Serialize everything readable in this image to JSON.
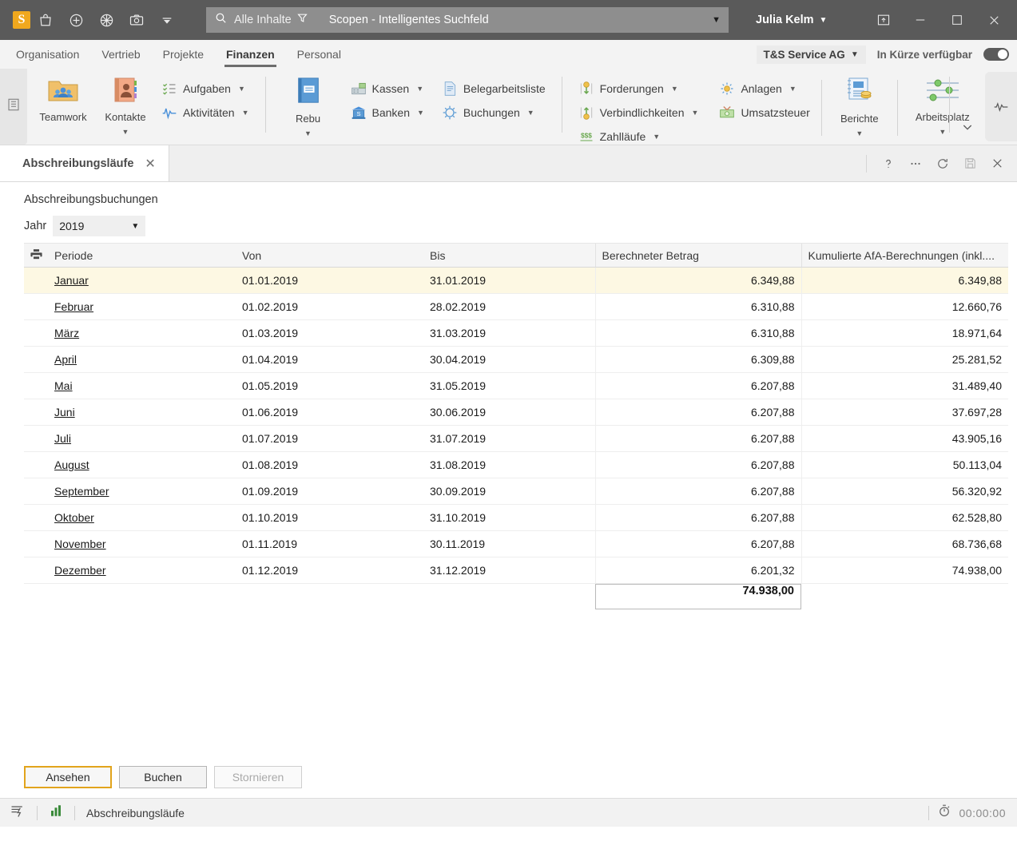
{
  "titlebar": {
    "logo_text": "S",
    "icons": [
      "bag-icon",
      "plus-circle-icon",
      "globe-icon",
      "camera-icon",
      "chevron-down-icon"
    ],
    "search": {
      "icon": "search-icon",
      "scope_label": "Alle Inhalte",
      "filter_icon": "filter-icon",
      "placeholder": "Scopen - Intelligentes Suchfeld",
      "value": "Scopen - Intelligentes Suchfeld",
      "caret": "▼"
    },
    "user": {
      "name": "Julia Kelm",
      "caret": "▼"
    },
    "window_icon": "restore-panel-icon",
    "minimize": "—",
    "maximize": "☐",
    "close": "✕"
  },
  "menubar": {
    "items": [
      {
        "label": "Organisation",
        "active": false
      },
      {
        "label": "Vertrieb",
        "active": false
      },
      {
        "label": "Projekte",
        "active": false
      },
      {
        "label": "Finanzen",
        "active": true
      },
      {
        "label": "Personal",
        "active": false
      }
    ],
    "company": {
      "label": "T&S Service AG",
      "caret": "▼"
    },
    "coming_soon_label": "In Kürze verfügbar",
    "toggle_state": "on"
  },
  "ribbon": {
    "tabstrip_icon": "list-panel-icon",
    "big_buttons": [
      {
        "label": "Teamwork",
        "icon": "teamwork-folder-icon",
        "has_caret": false
      },
      {
        "label": "Kontakte",
        "icon": "contacts-book-icon",
        "has_caret": true
      },
      {
        "label": "Rebu",
        "icon": "rebu-book-icon",
        "has_caret": true
      },
      {
        "label": "Berichte",
        "icon": "reports-icon",
        "has_caret": true
      },
      {
        "label": "Arbeitsplatz",
        "icon": "workplace-sliders-icon",
        "has_caret": true
      }
    ],
    "group_tasks": [
      {
        "label": "Aufgaben",
        "icon": "tasks-icon",
        "caret": true
      },
      {
        "label": "Aktivitäten",
        "icon": "activity-pulse-icon",
        "caret": true
      }
    ],
    "group_cash": [
      {
        "label": "Kassen",
        "icon": "cash-register-icon",
        "caret": true
      },
      {
        "label": "Banken",
        "icon": "bank-icon",
        "caret": true
      }
    ],
    "group_docs": [
      {
        "label": "Belegarbeitsliste",
        "icon": "document-list-icon",
        "caret": false
      },
      {
        "label": "Buchungen",
        "icon": "bookings-target-icon",
        "caret": true
      }
    ],
    "group_receivables": [
      {
        "label": "Forderungen",
        "icon": "receivables-icon",
        "caret": true
      },
      {
        "label": "Verbindlichkeiten",
        "icon": "payables-icon",
        "caret": true
      },
      {
        "label": "Zahlläufe",
        "icon": "payment-runs-icon",
        "caret": true
      }
    ],
    "group_assets": [
      {
        "label": "Anlagen",
        "icon": "assets-icon",
        "caret": true
      },
      {
        "label": "Umsatzsteuer",
        "icon": "vat-money-icon",
        "caret": false
      }
    ],
    "collapse_icon": "chevron-down-icon",
    "pulse_icon": "activity-pulse-icon"
  },
  "doctab": {
    "title": "Abschreibungsläufe",
    "close": "✕",
    "actions": [
      "help-icon",
      "more-options-icon",
      "refresh-icon",
      "save-icon",
      "close-icon"
    ]
  },
  "form": {
    "title": "Abschreibungsbuchungen",
    "year_label": "Jahr",
    "year_value": "2019",
    "year_caret": "▼",
    "print_icon": "printer-icon"
  },
  "table": {
    "columns": [
      "Periode",
      "Von",
      "Bis",
      "Berechneter Betrag",
      "Kumulierte AfA-Berechnungen (inkl...."
    ],
    "selected_row_index": 0,
    "rows": [
      {
        "periode": "Januar",
        "von": "01.01.2019",
        "bis": "31.01.2019",
        "betrag": "6.349,88",
        "kumuliert": "6.349,88"
      },
      {
        "periode": "Februar",
        "von": "01.02.2019",
        "bis": "28.02.2019",
        "betrag": "6.310,88",
        "kumuliert": "12.660,76"
      },
      {
        "periode": "März",
        "von": "01.03.2019",
        "bis": "31.03.2019",
        "betrag": "6.310,88",
        "kumuliert": "18.971,64"
      },
      {
        "periode": "April",
        "von": "01.04.2019",
        "bis": "30.04.2019",
        "betrag": "6.309,88",
        "kumuliert": "25.281,52"
      },
      {
        "periode": "Mai",
        "von": "01.05.2019",
        "bis": "31.05.2019",
        "betrag": "6.207,88",
        "kumuliert": "31.489,40"
      },
      {
        "periode": "Juni",
        "von": "01.06.2019",
        "bis": "30.06.2019",
        "betrag": "6.207,88",
        "kumuliert": "37.697,28"
      },
      {
        "periode": "Juli",
        "von": "01.07.2019",
        "bis": "31.07.2019",
        "betrag": "6.207,88",
        "kumuliert": "43.905,16"
      },
      {
        "periode": "August",
        "von": "01.08.2019",
        "bis": "31.08.2019",
        "betrag": "6.207,88",
        "kumuliert": "50.113,04"
      },
      {
        "periode": "September",
        "von": "01.09.2019",
        "bis": "30.09.2019",
        "betrag": "6.207,88",
        "kumuliert": "56.320,92"
      },
      {
        "periode": "Oktober",
        "von": "01.10.2019",
        "bis": "31.10.2019",
        "betrag": "6.207,88",
        "kumuliert": "62.528,80"
      },
      {
        "periode": "November",
        "von": "01.11.2019",
        "bis": "30.11.2019",
        "betrag": "6.207,88",
        "kumuliert": "68.736,68"
      },
      {
        "periode": "Dezember",
        "von": "01.12.2019",
        "bis": "31.12.2019",
        "betrag": "6.201,32",
        "kumuliert": "74.938,00"
      }
    ],
    "sum_betrag": "74.938,00"
  },
  "footer": {
    "buttons": [
      {
        "label": "Ansehen",
        "style": "primary"
      },
      {
        "label": "Buchen",
        "style": "normal"
      },
      {
        "label": "Stornieren",
        "style": "disabled"
      }
    ]
  },
  "statusbar": {
    "left_icon": "flash-list-icon",
    "chart_icon": "bar-chart-icon",
    "text": "Abschreibungsläufe",
    "timer_icon": "stopwatch-icon",
    "timer": "00:00:00"
  },
  "colors": {
    "titlebar_bg": "#5a5a5a",
    "accent_orange": "#f0a81e",
    "selected_row": "#fdf8e3",
    "ribbon_bg": "#f3f3f3"
  }
}
